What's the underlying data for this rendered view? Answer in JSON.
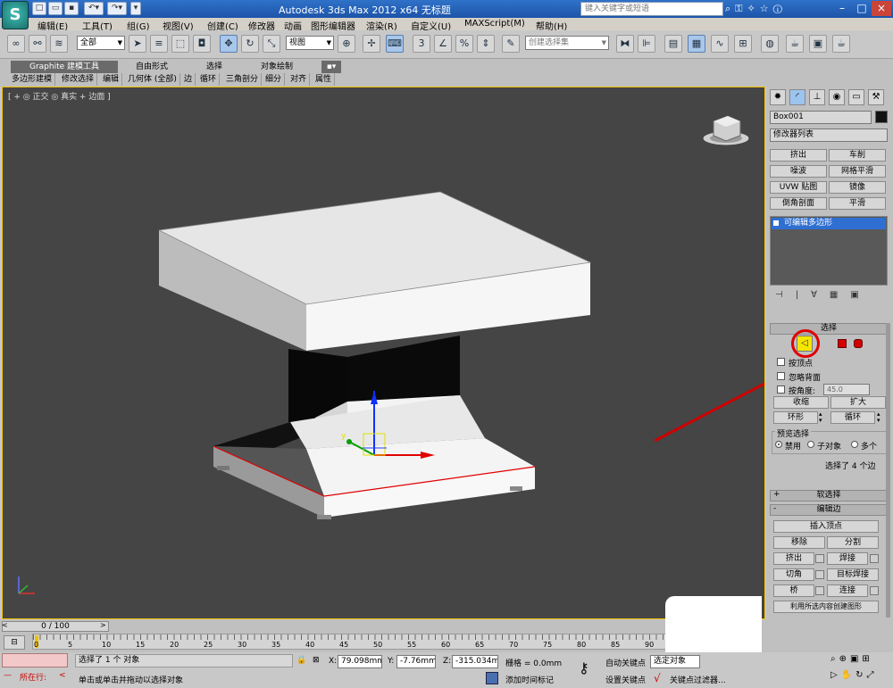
{
  "titlebar": {
    "app_title": "Autodesk 3ds Max  2012 x64     无标题",
    "search_placeholder": "键入关键字或短语",
    "logo": "S"
  },
  "menus": [
    "编辑(E)",
    "工具(T)",
    "组(G)",
    "视图(V)",
    "创建(C)",
    "修改器",
    "动画",
    "图形编辑器",
    "渲染(R)",
    "自定义(U)",
    "MAXScript(M)",
    "帮助(H)"
  ],
  "toolbar": {
    "filter_value": "全部",
    "ref_coord_value": "视图",
    "named_selection_placeholder": "创建选择集"
  },
  "ribbon": {
    "tabs": [
      "Graphite 建模工具",
      "自由形式",
      "选择",
      "对象绘制"
    ],
    "subtabs": [
      "多边形建模",
      "修改选择",
      "编辑",
      "几何体 (全部)",
      "边",
      "循环",
      "三角剖分",
      "细分",
      "对齐",
      "属性"
    ]
  },
  "viewport": {
    "label": "[ + ◎ 正交 ◎ 真实 + 边面 ]",
    "axis_y": "y"
  },
  "panel": {
    "object_name": "Box001",
    "modifier_list": "修改器列表",
    "modifier_buttons": [
      "挤出",
      "车削",
      "噪波",
      "网格平滑",
      "UVW 贴图",
      "镜像",
      "倒角剖面",
      "平滑"
    ],
    "stack_item": "可编辑多边形",
    "selection_title": "选择",
    "by_vertex": "按顶点",
    "ignore_backfacing": "忽略背面",
    "by_angle": "按角度:",
    "angle_value": "45.0",
    "shrink": "收缩",
    "grow": "扩大",
    "ring": "环形",
    "loop": "循环",
    "preview_title": "预览选择",
    "preview_disabled": "禁用",
    "preview_subobj": "子对象",
    "preview_multi": "多个",
    "selected_text": "选择了 4 个边",
    "soft_selection": "软选择",
    "edit_edges": "编辑边",
    "insert_vertex": "插入顶点",
    "remove": "移除",
    "split": "分割",
    "extrude": "挤出",
    "weld": "焊接",
    "chamfer": "切角",
    "target_weld": "目标焊接",
    "bridge": "桥",
    "connect": "连接",
    "create_shape": "利用所选内容创建图形"
  },
  "timeline": {
    "frame_counter": "0 / 100",
    "ticks": [
      "0",
      "5",
      "10",
      "15",
      "20",
      "25",
      "30",
      "35",
      "40",
      "45",
      "50",
      "55",
      "60",
      "65",
      "70",
      "75",
      "80",
      "85",
      "90"
    ]
  },
  "status": {
    "listener": "所在行:",
    "selected": "选择了 1 个 对象",
    "prompt": "单击或单击并拖动以选择对象",
    "x_label": "X:",
    "x_value": "79.098mm",
    "y_label": "Y:",
    "y_value": "-7.76mm",
    "z_label": "Z:",
    "z_value": "-315.034m",
    "grid": "栅格 = 0.0mm",
    "add_time_tag": "添加时间标记",
    "auto_key": "自动关键点",
    "set_key": "设置关键点",
    "selected_obj": "选定对象",
    "key_filters": "关键点过滤器..."
  },
  "colors": {
    "accent_yellow": "#f5e600",
    "highlight_red": "#e00000",
    "viewport_bg": "#454545",
    "selection_blue": "#2f6fd1"
  }
}
